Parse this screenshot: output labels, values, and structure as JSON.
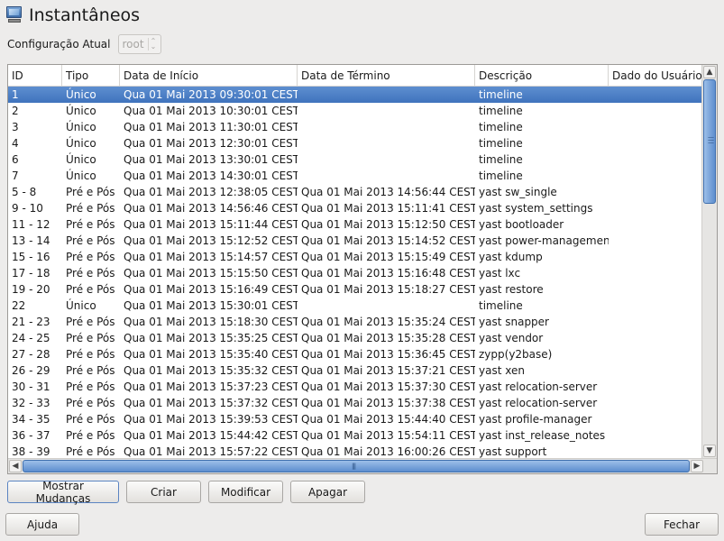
{
  "window": {
    "title": "Instantâneos",
    "icon": "snapshot-monitor-icon"
  },
  "config": {
    "label": "Configuração Atual",
    "value": "root"
  },
  "table": {
    "headers": [
      "ID",
      "Tipo",
      "Data de Início",
      "Data de Término",
      "Descrição",
      "Dado do Usuário"
    ],
    "rows": [
      [
        "1",
        "Único",
        "Qua 01 Mai 2013 09:30:01 CEST",
        "",
        "timeline",
        ""
      ],
      [
        "2",
        "Único",
        "Qua 01 Mai 2013 10:30:01 CEST",
        "",
        "timeline",
        ""
      ],
      [
        "3",
        "Único",
        "Qua 01 Mai 2013 11:30:01 CEST",
        "",
        "timeline",
        ""
      ],
      [
        "4",
        "Único",
        "Qua 01 Mai 2013 12:30:01 CEST",
        "",
        "timeline",
        ""
      ],
      [
        "6",
        "Único",
        "Qua 01 Mai 2013 13:30:01 CEST",
        "",
        "timeline",
        ""
      ],
      [
        "7",
        "Único",
        "Qua 01 Mai 2013 14:30:01 CEST",
        "",
        "timeline",
        ""
      ],
      [
        "5 - 8",
        "Pré e Pós",
        "Qua 01 Mai 2013 12:38:05 CEST",
        "Qua 01 Mai 2013 14:56:44 CEST",
        "yast sw_single",
        ""
      ],
      [
        "9 - 10",
        "Pré e Pós",
        "Qua 01 Mai 2013 14:56:46 CEST",
        "Qua 01 Mai 2013 15:11:41 CEST",
        "yast system_settings",
        ""
      ],
      [
        "11 - 12",
        "Pré e Pós",
        "Qua 01 Mai 2013 15:11:44 CEST",
        "Qua 01 Mai 2013 15:12:50 CEST",
        "yast bootloader",
        ""
      ],
      [
        "13 - 14",
        "Pré e Pós",
        "Qua 01 Mai 2013 15:12:52 CEST",
        "Qua 01 Mai 2013 15:14:52 CEST",
        "yast power-management",
        ""
      ],
      [
        "15 - 16",
        "Pré e Pós",
        "Qua 01 Mai 2013 15:14:57 CEST",
        "Qua 01 Mai 2013 15:15:49 CEST",
        "yast kdump",
        ""
      ],
      [
        "17 - 18",
        "Pré e Pós",
        "Qua 01 Mai 2013 15:15:50 CEST",
        "Qua 01 Mai 2013 15:16:48 CEST",
        "yast lxc",
        ""
      ],
      [
        "19 - 20",
        "Pré e Pós",
        "Qua 01 Mai 2013 15:16:49 CEST",
        "Qua 01 Mai 2013 15:18:27 CEST",
        "yast restore",
        ""
      ],
      [
        "22",
        "Único",
        "Qua 01 Mai 2013 15:30:01 CEST",
        "",
        "timeline",
        ""
      ],
      [
        "21 - 23",
        "Pré e Pós",
        "Qua 01 Mai 2013 15:18:30 CEST",
        "Qua 01 Mai 2013 15:35:24 CEST",
        "yast snapper",
        ""
      ],
      [
        "24 - 25",
        "Pré e Pós",
        "Qua 01 Mai 2013 15:35:25 CEST",
        "Qua 01 Mai 2013 15:35:28 CEST",
        "yast vendor",
        ""
      ],
      [
        "27 - 28",
        "Pré e Pós",
        "Qua 01 Mai 2013 15:35:40 CEST",
        "Qua 01 Mai 2013 15:36:45 CEST",
        "zypp(y2base)",
        ""
      ],
      [
        "26 - 29",
        "Pré e Pós",
        "Qua 01 Mai 2013 15:35:32 CEST",
        "Qua 01 Mai 2013 15:37:21 CEST",
        "yast xen",
        ""
      ],
      [
        "30 - 31",
        "Pré e Pós",
        "Qua 01 Mai 2013 15:37:23 CEST",
        "Qua 01 Mai 2013 15:37:30 CEST",
        "yast relocation-server",
        ""
      ],
      [
        "32 - 33",
        "Pré e Pós",
        "Qua 01 Mai 2013 15:37:32 CEST",
        "Qua 01 Mai 2013 15:37:38 CEST",
        "yast relocation-server",
        ""
      ],
      [
        "34 - 35",
        "Pré e Pós",
        "Qua 01 Mai 2013 15:39:53 CEST",
        "Qua 01 Mai 2013 15:44:40 CEST",
        "yast profile-manager",
        ""
      ],
      [
        "36 - 37",
        "Pré e Pós",
        "Qua 01 Mai 2013 15:44:42 CEST",
        "Qua 01 Mai 2013 15:54:11 CEST",
        "yast inst_release_notes",
        ""
      ],
      [
        "38 - 39",
        "Pré e Pós",
        "Qua 01 Mai 2013 15:57:22 CEST",
        "Qua 01 Mai 2013 16:00:26 CEST",
        "yast support",
        ""
      ]
    ],
    "selected_index": 0
  },
  "buttons": {
    "show_changes": "Mostrar Mudanças",
    "create": "Criar",
    "modify": "Modificar",
    "delete": "Apagar",
    "help": "Ajuda",
    "close": "Fechar"
  },
  "colors": {
    "selection": "#4a7fc6",
    "background": "#edeceb"
  }
}
